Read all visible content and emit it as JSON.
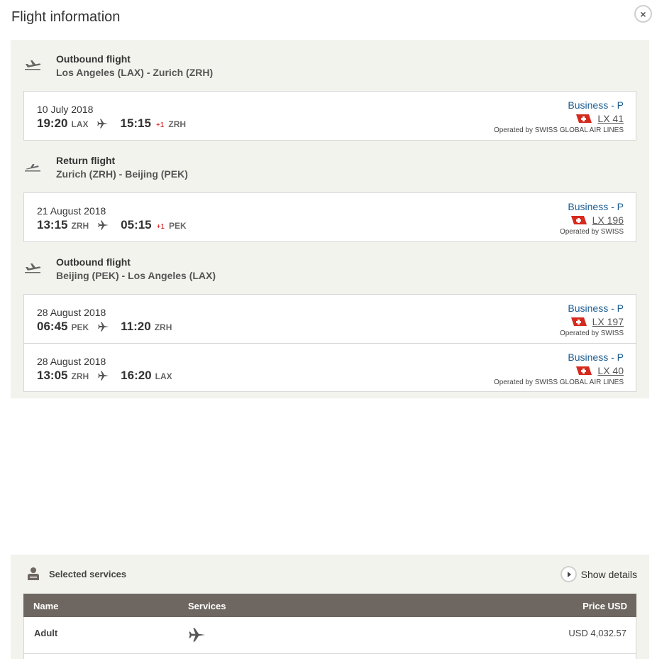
{
  "header": {
    "title": "Flight information",
    "close_label": "×"
  },
  "groups": [
    {
      "title": "Outbound flight",
      "route": "Los Angeles (LAX) - Zurich (ZRH)"
    },
    {
      "title": "Return flight",
      "route": "Zurich (ZRH) - Beijing (PEK)"
    },
    {
      "title": "Outbound flight",
      "route": "Beijing (PEK) - Los Angeles (LAX)"
    }
  ],
  "segments": [
    {
      "date": "10 July 2018",
      "dep_time": "19:20",
      "dep_code": "LAX",
      "arr_time": "15:15",
      "day_offset": "+1",
      "arr_code": "ZRH",
      "class": "Business - P",
      "flight": "LX 41",
      "operated": "Operated by SWISS GLOBAL AIR LINES"
    },
    {
      "date": "21 August 2018",
      "dep_time": "13:15",
      "dep_code": "ZRH",
      "arr_time": "05:15",
      "day_offset": "+1",
      "arr_code": "PEK",
      "class": "Business - P",
      "flight": "LX 196",
      "operated": "Operated by SWISS"
    },
    {
      "date": "28 August 2018",
      "dep_time": "06:45",
      "dep_code": "PEK",
      "arr_time": "11:20",
      "day_offset": "",
      "arr_code": "ZRH",
      "class": "Business - P",
      "flight": "LX 197",
      "operated": "Operated by SWISS"
    },
    {
      "date": "28 August 2018",
      "dep_time": "13:05",
      "dep_code": "ZRH",
      "arr_time": "16:20",
      "day_offset": "",
      "arr_code": "LAX",
      "class": "Business - P",
      "flight": "LX 40",
      "operated": "Operated by SWISS GLOBAL AIR LINES"
    }
  ],
  "services": {
    "title": "Selected services",
    "show_details": "Show details",
    "columns": {
      "name": "Name",
      "services": "Services",
      "price": "Price USD"
    },
    "rows": [
      {
        "name": "Adult",
        "price": "USD 4,032.57"
      }
    ]
  },
  "colors": {
    "accent_blue": "#1c5d91",
    "panel_bg": "#f3f3ee",
    "table_header": "#6e6660",
    "swiss_red": "#d52b1e"
  },
  "icons": {
    "takeoff": "plane-takeoff-icon",
    "landing": "plane-landing-icon",
    "plane": "plane-icon",
    "person": "person-icon",
    "flag": "swiss-tail-icon"
  }
}
